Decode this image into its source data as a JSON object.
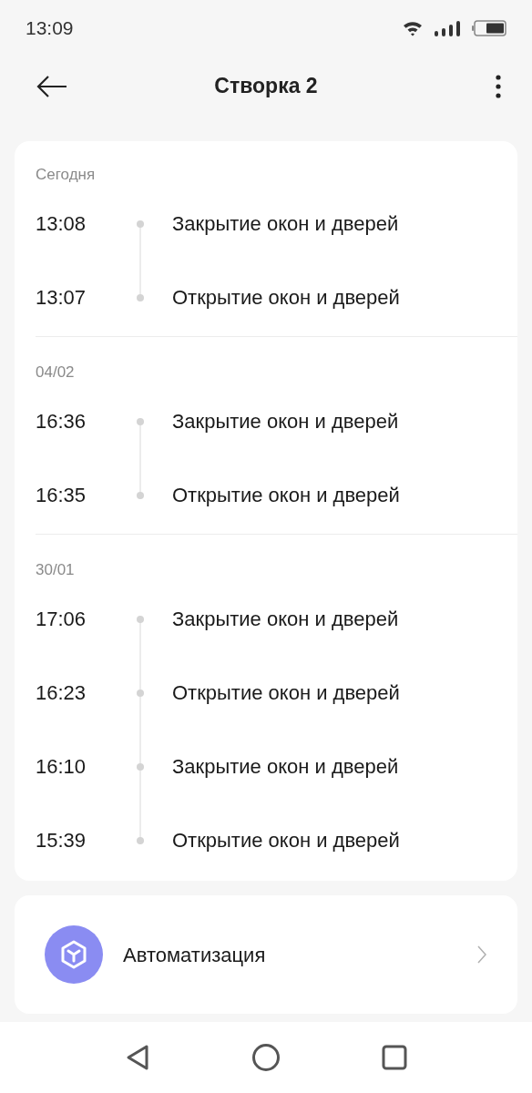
{
  "status_bar": {
    "time": "13:09"
  },
  "header": {
    "title": "Створка 2"
  },
  "history": [
    {
      "date": "Сегодня",
      "events": [
        {
          "time": "13:08",
          "text": "Закрытие окон и дверей"
        },
        {
          "time": "13:07",
          "text": "Открытие окон и дверей"
        }
      ]
    },
    {
      "date": "04/02",
      "events": [
        {
          "time": "16:36",
          "text": "Закрытие окон и дверей"
        },
        {
          "time": "16:35",
          "text": "Открытие окон и дверей"
        }
      ]
    },
    {
      "date": "30/01",
      "events": [
        {
          "time": "17:06",
          "text": "Закрытие окон и дверей"
        },
        {
          "time": "16:23",
          "text": "Открытие окон и дверей"
        },
        {
          "time": "16:10",
          "text": "Закрытие окон и дверей"
        },
        {
          "time": "15:39",
          "text": "Открытие окон и дверей"
        }
      ]
    }
  ],
  "automation": {
    "label": "Автоматизация"
  }
}
